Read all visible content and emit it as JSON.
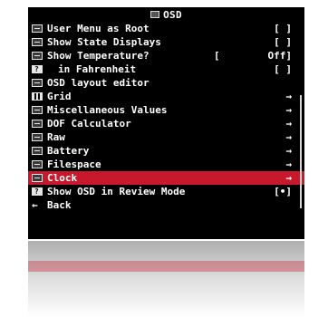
{
  "header": {
    "title": "OSD",
    "icon": "osd-icon"
  },
  "menu": [
    {
      "label": "User Menu as Root",
      "value": "[ ]",
      "icon": "menu-icon",
      "indent": false,
      "selected": false
    },
    {
      "label": "Show State Displays",
      "value": "[ ]",
      "icon": "list-icon",
      "indent": false,
      "selected": false
    },
    {
      "label": "Show Temperature?",
      "value": "Off]",
      "value_prefix": "[",
      "icon": "list-icon",
      "indent": false,
      "selected": false
    },
    {
      "label": "in Fahrenheit",
      "value": "[ ]",
      "icon": "help-icon",
      "indent": true,
      "selected": false
    },
    {
      "label": "OSD layout editor",
      "value": "",
      "icon": "layout-icon",
      "indent": false,
      "selected": false
    },
    {
      "label": "Grid",
      "value": "→",
      "icon": "grid-icon",
      "indent": false,
      "selected": false
    },
    {
      "label": "Miscellaneous Values",
      "value": "→",
      "icon": "misc-icon",
      "indent": false,
      "selected": false
    },
    {
      "label": "DOF Calculator",
      "value": "→",
      "icon": "dof-icon",
      "indent": false,
      "selected": false
    },
    {
      "label": "Raw",
      "value": "→",
      "icon": "raw-icon",
      "indent": false,
      "selected": false
    },
    {
      "label": "Battery",
      "value": "→",
      "icon": "battery-icon",
      "indent": false,
      "selected": false
    },
    {
      "label": "Filespace",
      "value": "→",
      "icon": "filespace-icon",
      "indent": false,
      "selected": false
    },
    {
      "label": "Clock",
      "value": "→",
      "icon": "clock-icon",
      "indent": false,
      "selected": true
    },
    {
      "label": "Show OSD in Review Mode",
      "value": "[•]",
      "icon": "help-icon",
      "indent": false,
      "selected": false
    },
    {
      "label": "Back",
      "value": "",
      "icon": "back-arrow-icon",
      "indent": false,
      "selected": false
    }
  ],
  "colors": {
    "background": "#000000",
    "text": "#ffffff",
    "selected": "#c8182c"
  }
}
